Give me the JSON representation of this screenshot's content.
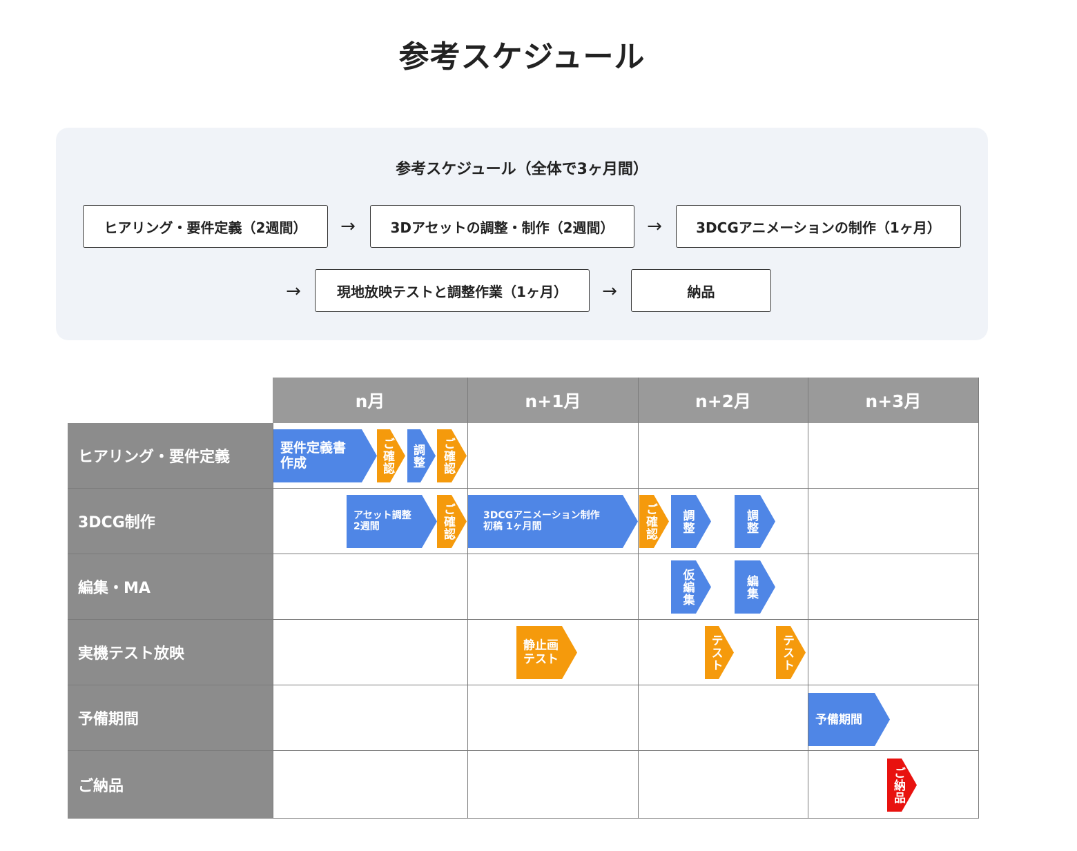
{
  "title": "参考スケジュール",
  "flow": {
    "title": "参考スケジュール（全体で3ヶ月間）",
    "steps": [
      "ヒアリング・要件定義（2週間）",
      "3Dアセットの調整・制作（2週間）",
      "3DCGアニメーションの制作（1ヶ月）",
      "現地放映テストと調整作業（1ヶ月）",
      "納品"
    ],
    "arrow": "→"
  },
  "gantt": {
    "months": [
      "n月",
      "n+1月",
      "n+2月",
      "n+3月"
    ],
    "rows": [
      "ヒアリング・要件定義",
      "3DCG制作",
      "編集・MA",
      "実機テスト放映",
      "予備期間",
      "ご納品"
    ],
    "bars": [
      {
        "text": "要件定義書\n作成",
        "color": "blue"
      },
      {
        "text": "ご確認",
        "color": "orange"
      },
      {
        "text": "調整",
        "color": "blue"
      },
      {
        "text": "ご確認",
        "color": "orange"
      },
      {
        "text": "アセット調整\n2週間",
        "color": "blue"
      },
      {
        "text": "ご確認",
        "color": "orange"
      },
      {
        "text": "3DCGアニメーション制作\n初稿 1ヶ月間",
        "color": "blue"
      },
      {
        "text": "ご確認",
        "color": "orange"
      },
      {
        "text": "調整",
        "color": "blue"
      },
      {
        "text": "調整",
        "color": "blue"
      },
      {
        "text": "仮編集",
        "color": "blue"
      },
      {
        "text": "編集",
        "color": "blue"
      },
      {
        "text": "静止画\nテスト",
        "color": "orange"
      },
      {
        "text": "テスト",
        "color": "orange"
      },
      {
        "text": "テスト",
        "color": "orange"
      },
      {
        "text": "予備期間",
        "color": "blue"
      },
      {
        "text": "ご納品",
        "color": "red"
      }
    ]
  },
  "colors": {
    "blue": "#4f86e6",
    "orange": "#f59a0c",
    "red": "#e8120f",
    "header": "#9a9a9a",
    "label": "#8c8c8c"
  }
}
